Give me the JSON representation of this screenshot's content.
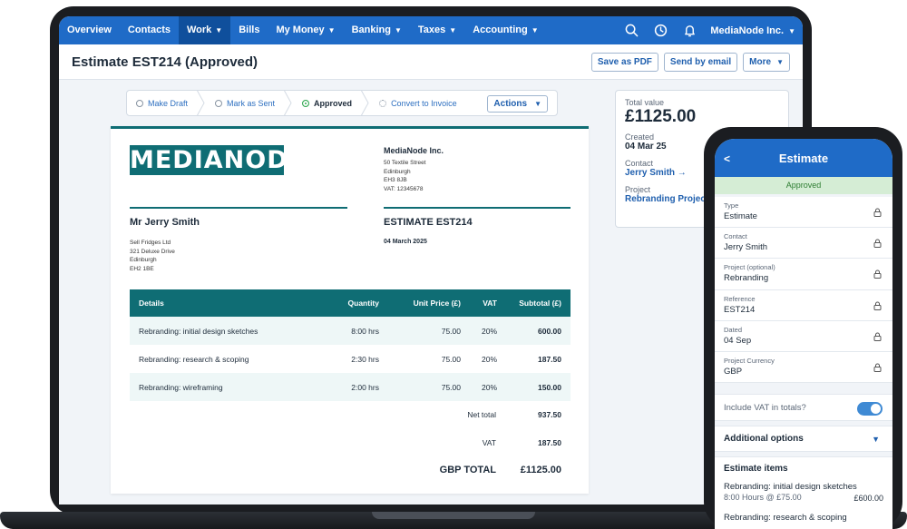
{
  "nav": {
    "items": [
      {
        "label": "Overview",
        "dropdown": false,
        "active": false
      },
      {
        "label": "Contacts",
        "dropdown": false,
        "active": false
      },
      {
        "label": "Work",
        "dropdown": true,
        "active": true
      },
      {
        "label": "Bills",
        "dropdown": false,
        "active": false
      },
      {
        "label": "My Money",
        "dropdown": true,
        "active": false
      },
      {
        "label": "Banking",
        "dropdown": true,
        "active": false
      },
      {
        "label": "Taxes",
        "dropdown": true,
        "active": false
      },
      {
        "label": "Accounting",
        "dropdown": true,
        "active": false
      }
    ],
    "company": "MediaNode Inc.",
    "icons": [
      "search-icon",
      "timer-icon",
      "bell-icon"
    ]
  },
  "title": {
    "text": "Estimate EST214 (Approved)",
    "buttons": {
      "pdf": "Save as PDF",
      "email": "Send by email",
      "more": "More"
    }
  },
  "stepper": {
    "steps": [
      {
        "label": "Make Draft",
        "state": "pending"
      },
      {
        "label": "Mark as Sent",
        "state": "pending"
      },
      {
        "label": "Approved",
        "state": "done"
      },
      {
        "label": "Convert to Invoice",
        "state": "next"
      }
    ],
    "actions": "Actions"
  },
  "doc": {
    "logo": "MEDIANODE",
    "company": {
      "name": "MediaNode Inc.",
      "address": [
        "50 Textile Street",
        "Edinburgh",
        "EH3 8JB",
        "VAT: 12345678"
      ]
    },
    "client": {
      "name": "Mr Jerry Smith",
      "address": [
        "Sell Fridges Ltd",
        "321 Deluxe Drive",
        "Edinburgh",
        "EH2 1BE"
      ]
    },
    "estimate_title": "ESTIMATE EST214",
    "date": "04 March 2025",
    "columns": [
      "Details",
      "Quantity",
      "Unit Price (£)",
      "VAT",
      "Subtotal (£)"
    ],
    "rows": [
      {
        "details": "Rebranding: initial design sketches",
        "quantity": "8:00 hrs",
        "unit_price": "75.00",
        "vat": "20%",
        "subtotal": "600.00"
      },
      {
        "details": "Rebranding: research & scoping",
        "quantity": "2:30 hrs",
        "unit_price": "75.00",
        "vat": "20%",
        "subtotal": "187.50"
      },
      {
        "details": "Rebranding: wireframing",
        "quantity": "2:00 hrs",
        "unit_price": "75.00",
        "vat": "20%",
        "subtotal": "150.00"
      }
    ],
    "totals": {
      "net_label": "Net total",
      "net": "937.50",
      "vat_label": "VAT",
      "vat": "187.50",
      "grand_label": "GBP TOTAL",
      "grand": "£1125.00"
    }
  },
  "summary": {
    "total_label": "Total value",
    "total": "£1125.00",
    "created_label": "Created",
    "created": "04 Mar 25",
    "contact_label": "Contact",
    "contact": "Jerry Smith →",
    "project_label": "Project",
    "project": "Rebranding Project"
  },
  "phone": {
    "back": "<",
    "title": "Estimate",
    "status": "Approved",
    "fields": [
      {
        "label": "Type",
        "value": "Estimate"
      },
      {
        "label": "Contact",
        "value": "Jerry Smith"
      },
      {
        "label": "Project (optional)",
        "value": "Rebranding"
      },
      {
        "label": "Reference",
        "value": "EST214"
      },
      {
        "label": "Dated",
        "value": "04 Sep"
      },
      {
        "label": "Project Currency",
        "value": "GBP"
      }
    ],
    "vat_toggle": {
      "label": "Include VAT in totals?",
      "on": true
    },
    "additional": "Additional options",
    "items_title": "Estimate items",
    "items": [
      {
        "name": "Rebranding: initial design sketches",
        "detail": "8:00 Hours @ £75.00",
        "amount": "£600.00"
      },
      {
        "name": "Rebranding: research & scoping",
        "detail": "",
        "amount": ""
      }
    ]
  },
  "colors": {
    "brand_blue": "#1f6bc7",
    "teal": "#0f6d74",
    "approved_green": "#31a851"
  }
}
